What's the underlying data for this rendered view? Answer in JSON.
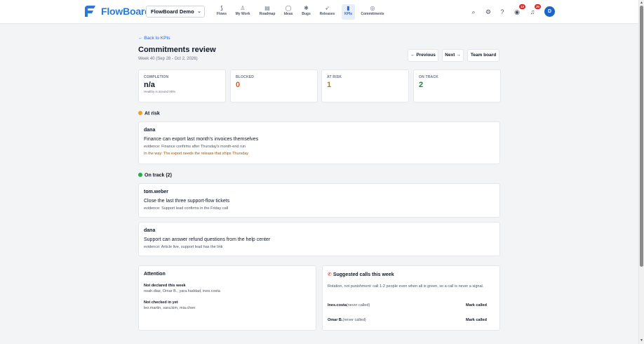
{
  "app": {
    "name": "FlowBoard",
    "project": "FlowBoard Demo",
    "user_initial": "D"
  },
  "nav": [
    {
      "label": "Flows",
      "icon": "flows-icon",
      "glyph": "⟆"
    },
    {
      "label": "My Work",
      "icon": "person-icon",
      "glyph": "♙"
    },
    {
      "label": "Roadmap",
      "icon": "roadmap-icon",
      "glyph": "▤"
    },
    {
      "label": "Ideas",
      "icon": "lightbulb-icon",
      "glyph": "◯"
    },
    {
      "label": "Bugs",
      "icon": "bug-icon",
      "glyph": "✱"
    },
    {
      "label": "Releases",
      "icon": "rocket-icon",
      "glyph": "➶"
    },
    {
      "label": "KPIs",
      "icon": "bar-chart-icon",
      "glyph": "▮"
    },
    {
      "label": "Commitments",
      "icon": "commitments-icon",
      "glyph": "◎"
    }
  ],
  "topbar": {
    "notifications_badge_1": "12",
    "notifications_badge_2": "30"
  },
  "header": {
    "back": "← Back to KPIs",
    "title": "Commitments review",
    "week": "Week 40 (Sep 28 - Oct 2, 2026)",
    "prev": "← Previous",
    "next": "Next →",
    "team_board": "Team board"
  },
  "stats": [
    {
      "label": "COMPLETION",
      "value": "n/a",
      "sub": "Healthy is around 90%",
      "color": "#111827"
    },
    {
      "label": "BLOCKED",
      "value": "0",
      "sub": "",
      "color": "#dc5a1e"
    },
    {
      "label": "AT RISK",
      "value": "1",
      "sub": "",
      "color": "#c27a00"
    },
    {
      "label": "ON TRACK",
      "value": "2",
      "sub": "",
      "color": "#16843c"
    }
  ],
  "at_risk": {
    "heading": "At risk",
    "dot_color": "#f0a020",
    "items": [
      {
        "owner": "dana",
        "title": "Finance can export last month's invoices themselves",
        "evidence": "evidence: Finance confirms after Thursday's month-end run",
        "blocker": "In the way: The export needs the release that ships Thursday"
      }
    ]
  },
  "on_track": {
    "heading": "On track (2)",
    "dot_color": "#22b04b",
    "items": [
      {
        "owner": "tom.weber",
        "title": "Close the last three support-flow tickets",
        "evidence": "evidence: Support lead confirms in the Friday call"
      },
      {
        "owner": "dana",
        "title": "Support can answer refund questions from the help center",
        "evidence": "evidence: Article live, support lead has the link"
      }
    ]
  },
  "attention": {
    "title": "Attention",
    "not_declared_label": "Not declared this week",
    "not_declared": "noah.diaz, Omar B., yara.haddad, ines.costa",
    "not_checked_label": "Not checked in yet",
    "not_checked": "leo.martin, sara.kim, mia.chen"
  },
  "calls": {
    "title": "Suggested calls this week",
    "description": "Rotation, not punishment: call 1-2 people even when all is green, so a call is never a signal.",
    "rows": [
      {
        "name": "Ines.costa",
        "note": "(never called)",
        "action": "Mark called"
      },
      {
        "name": "Omar B.",
        "note": "(never called)",
        "action": "Mark called"
      }
    ]
  }
}
